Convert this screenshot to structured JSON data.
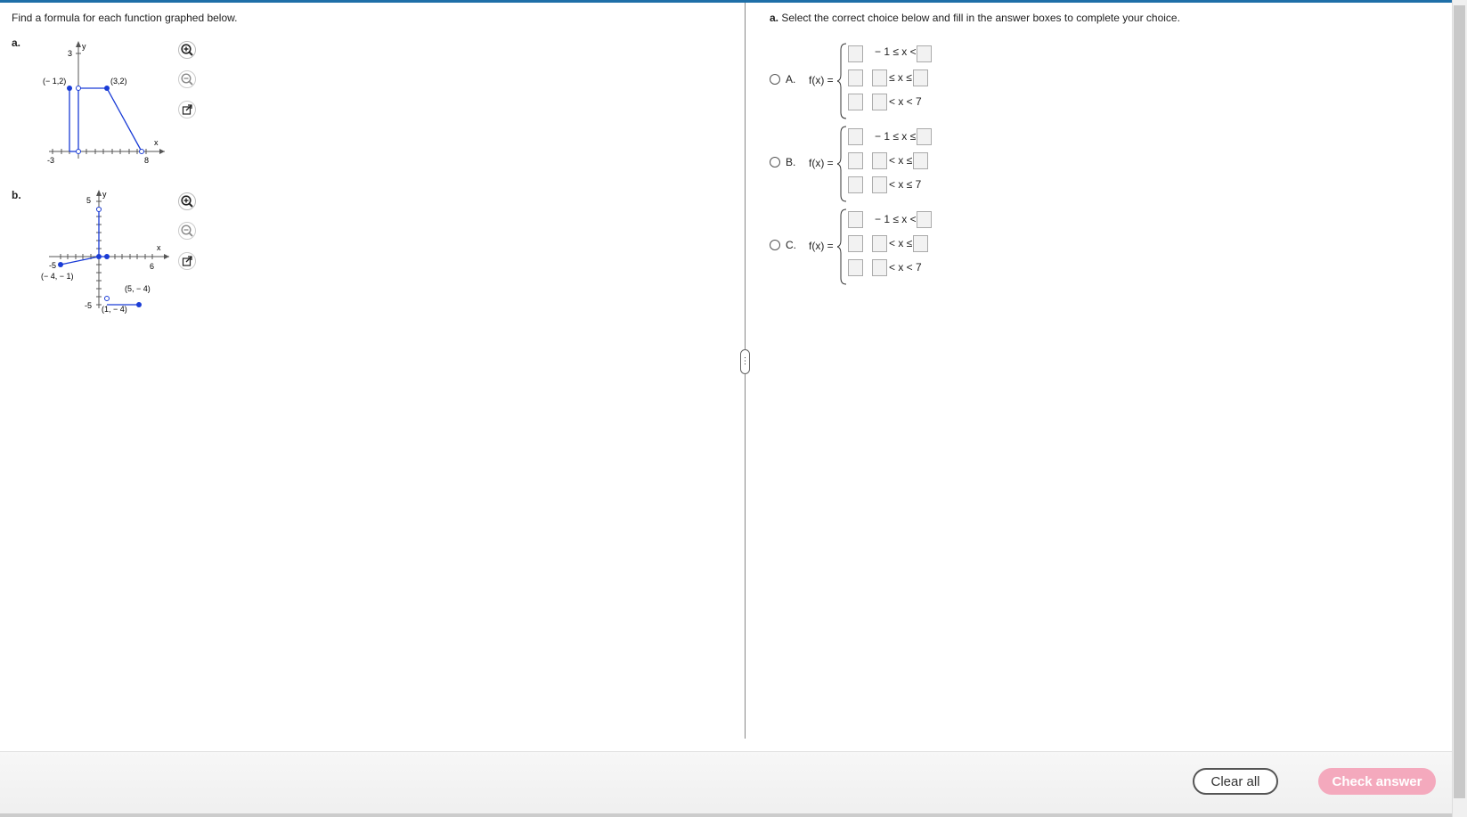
{
  "instructions": "Find a formula for each function graphed below.",
  "parts": {
    "a_label": "a.",
    "b_label": "b."
  },
  "graph_a": {
    "y_tick": "3",
    "x_tick_left": "-3",
    "x_tick_right": "8",
    "y_axis": "y",
    "x_axis": "x",
    "point_1": "(− 1,2)",
    "point_2": "(3,2)"
  },
  "graph_b": {
    "y_tick_top": "5",
    "y_tick_bottom": "-5",
    "x_tick_left": "-5",
    "x_tick_right": "6",
    "y_axis": "y",
    "x_axis": "x",
    "point_1": "(− 4, − 1)",
    "point_2": "(5, − 4)",
    "point_3": "(1, − 4)"
  },
  "question": {
    "part": "a.",
    "text": "Select the correct choice below and fill in the answer boxes to complete your choice."
  },
  "choices": [
    {
      "letter": "A.",
      "fx": "f(x) =",
      "row1": "− 1 ≤ x <",
      "row2": "≤ x ≤",
      "row3": "< x < 7"
    },
    {
      "letter": "B.",
      "fx": "f(x) =",
      "row1": "− 1 ≤ x ≤",
      "row2": "< x ≤",
      "row3": "< x ≤ 7"
    },
    {
      "letter": "C.",
      "fx": "f(x) =",
      "row1": "− 1 ≤ x <",
      "row2": "< x ≤",
      "row3": "< x < 7"
    }
  ],
  "footer": {
    "clear_label": "Clear all",
    "check_label": "Check answer"
  },
  "colors": {
    "accent": "#1e6fa8",
    "graph_line": "#1a3cd6",
    "check_button": "#f4a9bd"
  },
  "icons": [
    "zoom-in-icon",
    "zoom-out-icon",
    "popout-icon"
  ]
}
